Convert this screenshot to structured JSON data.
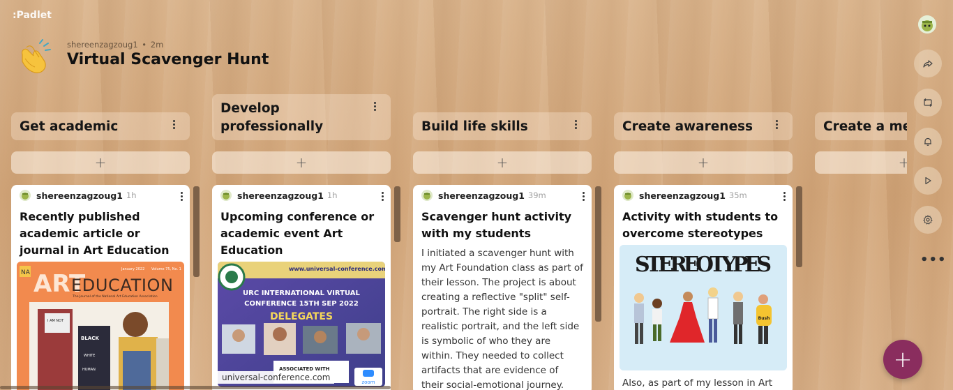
{
  "app": {
    "logo": ":Padlet"
  },
  "header": {
    "author": "shereenzagzoug1",
    "separator": "•",
    "time": "2m",
    "title": "Virtual Scavenger Hunt"
  },
  "columns": [
    {
      "title": "Get academic",
      "add_label": "+",
      "card": {
        "author": "shereenzagzoug1",
        "time": "1h",
        "title": "Recently published academic article or journal in Art Education",
        "image": {
          "month": "January 2022",
          "volume": "Volume 75, No. 1",
          "brand_a": "ART",
          "brand_b": "EDUCATION",
          "tagline": "The Journal of the National Art Education Association",
          "shirt_1": "BLACK",
          "shirt_2": "WHITE",
          "shirt_3": "HUMAN"
        }
      }
    },
    {
      "title": "Develop professionally",
      "title_line1": "Develop",
      "title_line2": "professionally",
      "add_label": "+",
      "card": {
        "author": "shereenzagzoug1",
        "time": "1h",
        "title": "Upcoming conference or academic event Art Education",
        "image": {
          "url_text": "www.universal-conference.com",
          "headline_1": "URC INTERNATIONAL VIRTUAL",
          "headline_2": "CONFERENCE 15TH SEP 2022",
          "headline_3": "DELEGATES",
          "associated": "ASSOCIATED WITH",
          "zoom": "zoom",
          "caption": "universal-conference.com"
        }
      }
    },
    {
      "title": "Build life skills",
      "add_label": "+",
      "card": {
        "author": "shereenzagzoug1",
        "time": "39m",
        "title": "Scavenger hunt activity with my students",
        "body": "I initiated a scavenger hunt with my Art Foundation class as part of their lesson. The project is about creating a reflective \"split\" self-portrait. The right side is a realistic portrait, and the left side is symbolic of who they are within. They needed to collect artifacts that are evidence of their social-emotional journey. These are some"
      }
    },
    {
      "title": "Create awareness",
      "add_label": "+",
      "card": {
        "author": "shereenzagzoug1",
        "time": "35m",
        "title": "Activity with students to overcome stereotypes",
        "image": {
          "heading": "STEREOTYPES",
          "tag": "Bush"
        },
        "body": "Also, as part of my lesson in Art"
      }
    },
    {
      "title": "Create a me",
      "add_label": "+"
    }
  ],
  "rail": {
    "share_icon": "share-icon",
    "remake_icon": "remake-icon",
    "bell_icon": "bell-icon",
    "play_icon": "play-icon",
    "settings_icon": "gear-icon",
    "more_label": "•••"
  },
  "fab": {
    "label": "+"
  },
  "colors": {
    "fab": "#8a2d5e",
    "scrollbar": "#7d6148",
    "wood": "#d7ae85"
  }
}
